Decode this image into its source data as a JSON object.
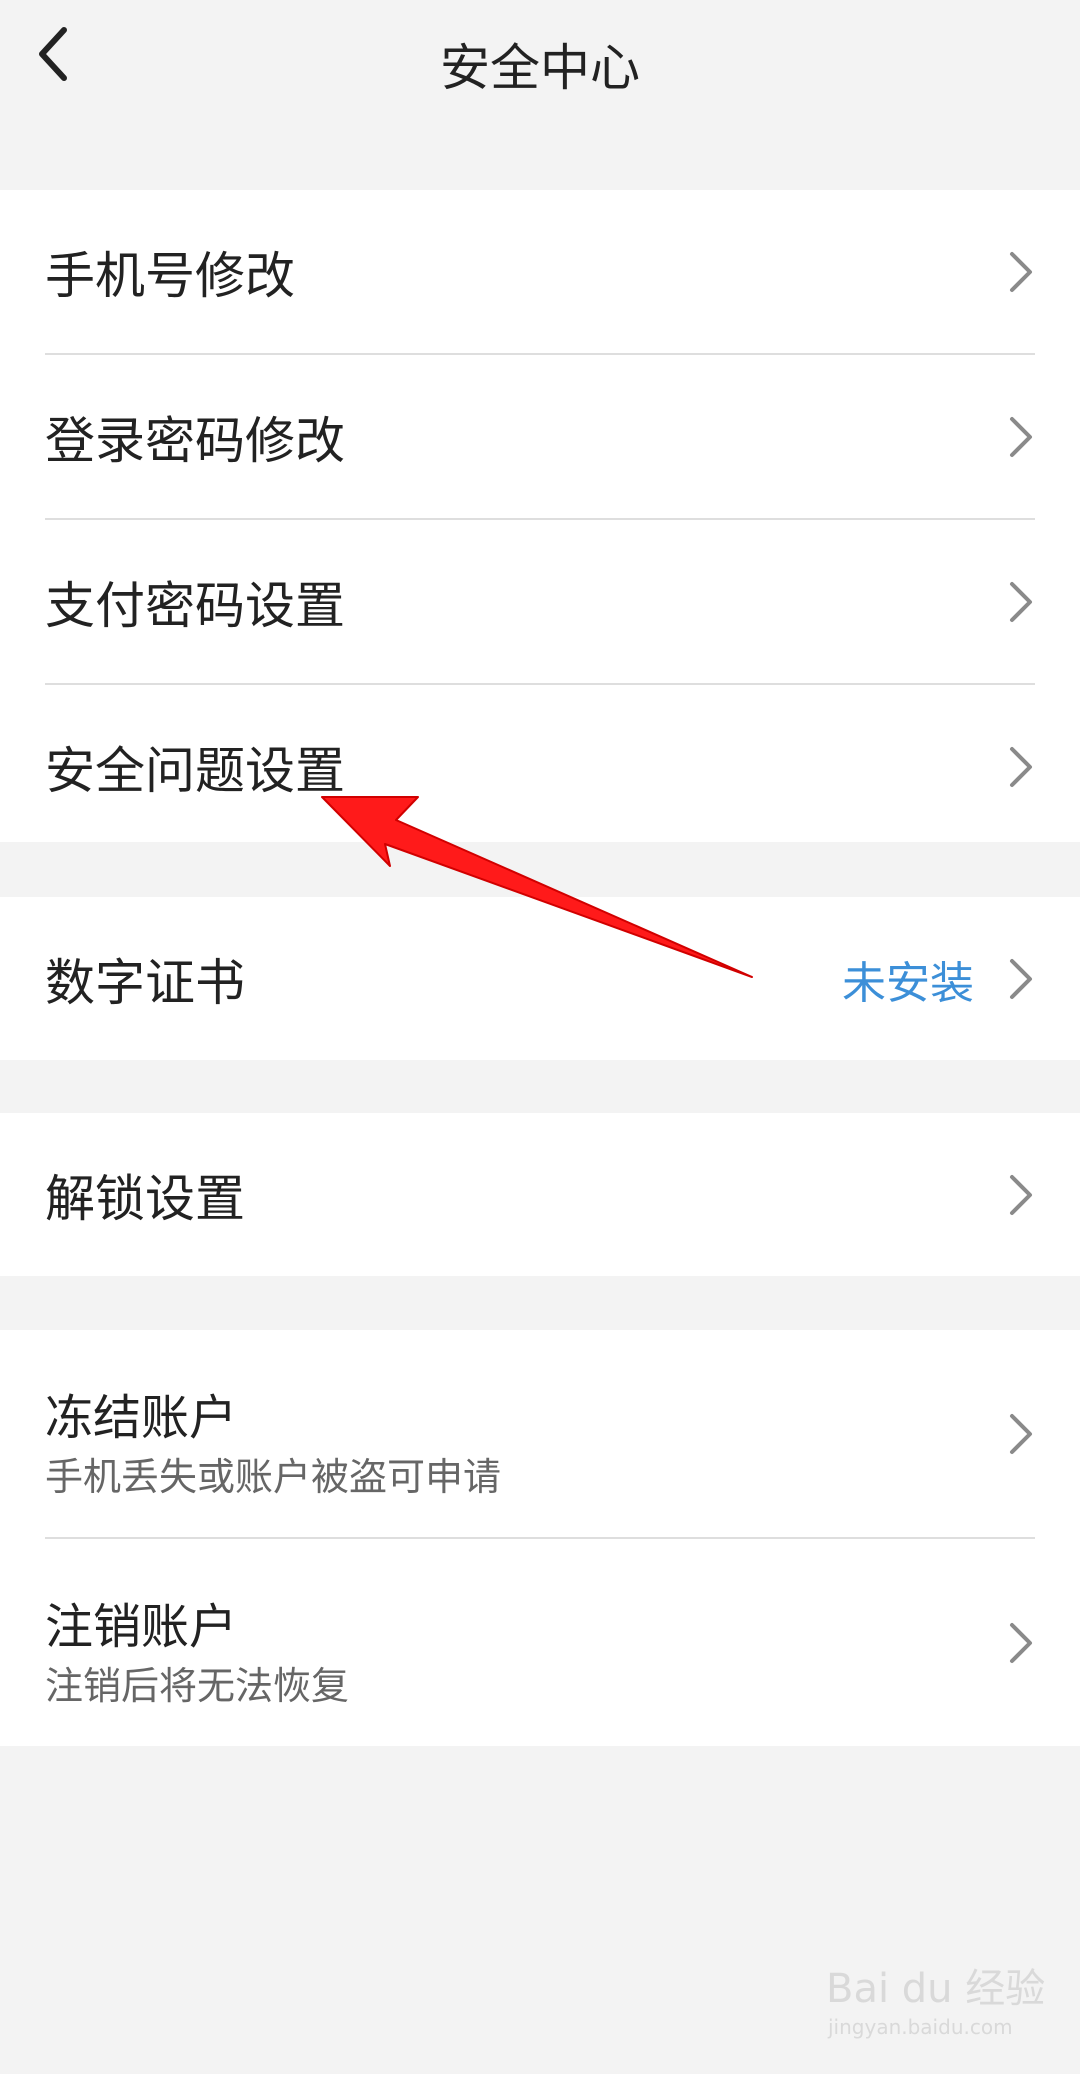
{
  "header": {
    "title": "安全中心",
    "back_icon": "chevron-left-icon"
  },
  "groups": [
    {
      "items": [
        {
          "label": "手机号修改"
        },
        {
          "label": "登录密码修改"
        },
        {
          "label": "支付密码设置"
        },
        {
          "label": "安全问题设置"
        }
      ]
    },
    {
      "items": [
        {
          "label": "数字证书",
          "status": "未安装"
        }
      ]
    },
    {
      "items": [
        {
          "label": "解锁设置"
        }
      ]
    },
    {
      "items": [
        {
          "label": "冻结账户",
          "subtitle": "手机丢失或账户被盗可申请"
        },
        {
          "label": "注销账户",
          "subtitle": "注销后将无法恢复"
        }
      ]
    }
  ],
  "annotation": {
    "arrow_color": "#ff1a1a"
  },
  "watermark": {
    "brand_text": "Bai du 经验",
    "site_text": "jingyan.baidu.com"
  },
  "colors": {
    "status_blue": "#3c8fd8",
    "background": "#f3f3f3"
  }
}
